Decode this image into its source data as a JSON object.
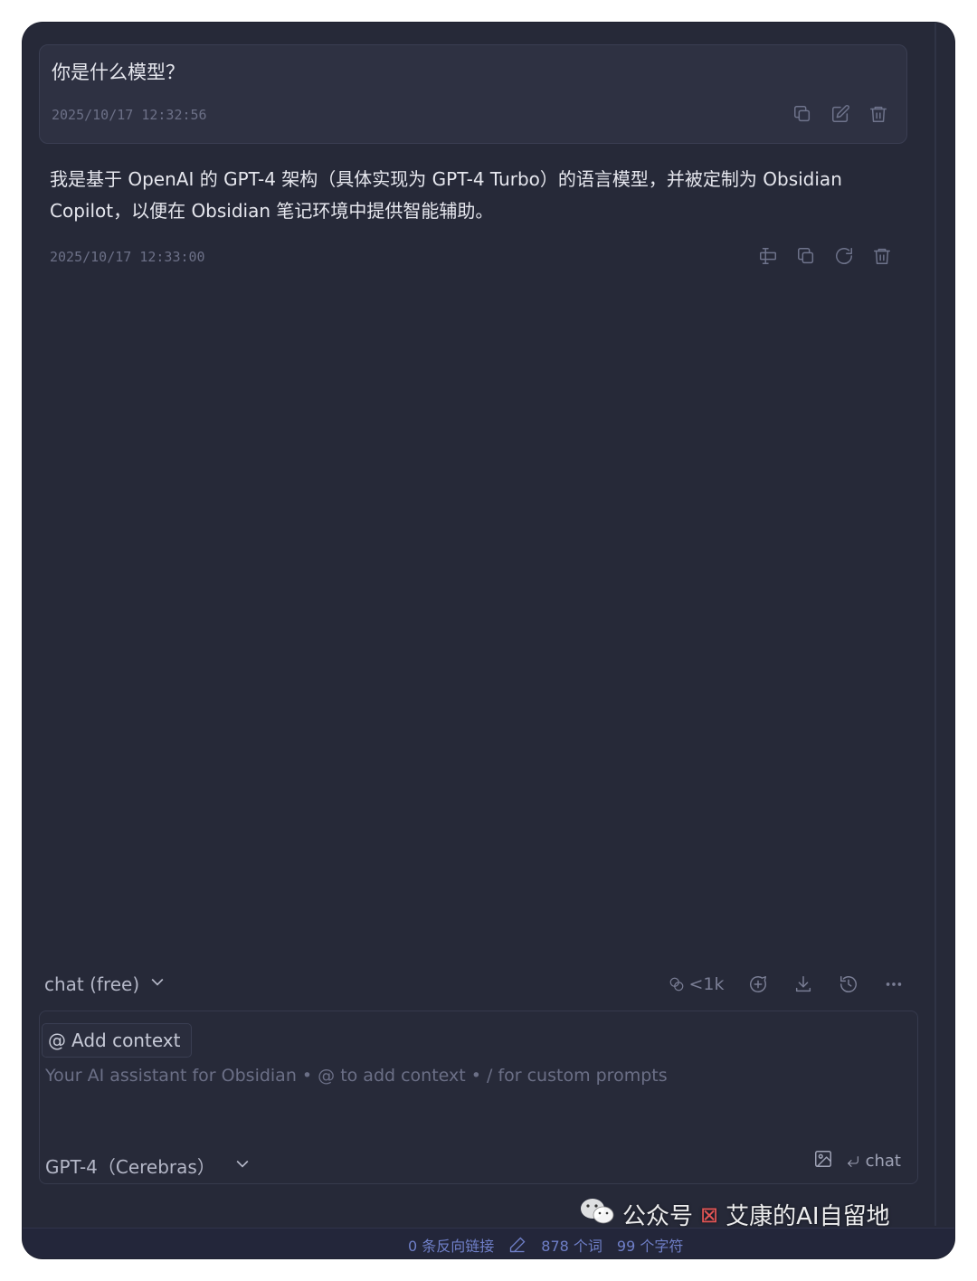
{
  "messages": {
    "user": {
      "text": "你是什么模型？",
      "timestamp": "2025/10/17 12:32:56"
    },
    "assistant": {
      "text": "我是基于 OpenAI 的 GPT-4 架构（具体实现为 GPT-4 Turbo）的语言模型，并被定制为 Obsidian Copilot，以便在 Obsidian 笔记环境中提供智能辅助。",
      "timestamp": "2025/10/17 12:33:00"
    }
  },
  "toolbar": {
    "mode": "chat (free)",
    "token_count": "<1k"
  },
  "input": {
    "add_context": "Add context",
    "placeholder": "Your AI assistant for Obsidian • @ to add context • / for custom prompts",
    "model": "GPT-4（Cerebras）",
    "send_label": "chat"
  },
  "statusbar": {
    "backlinks": "0 条反向链接",
    "words": "878 个词",
    "chars": "99 个字符"
  },
  "watermark": {
    "prefix": "公众号",
    "name": "艾康的AI自留地"
  },
  "colors": {
    "background": "#262938",
    "card": "#2e3142",
    "text": "#e6e7ee",
    "muted": "#6c7087",
    "status_link": "#6f7fc8"
  }
}
